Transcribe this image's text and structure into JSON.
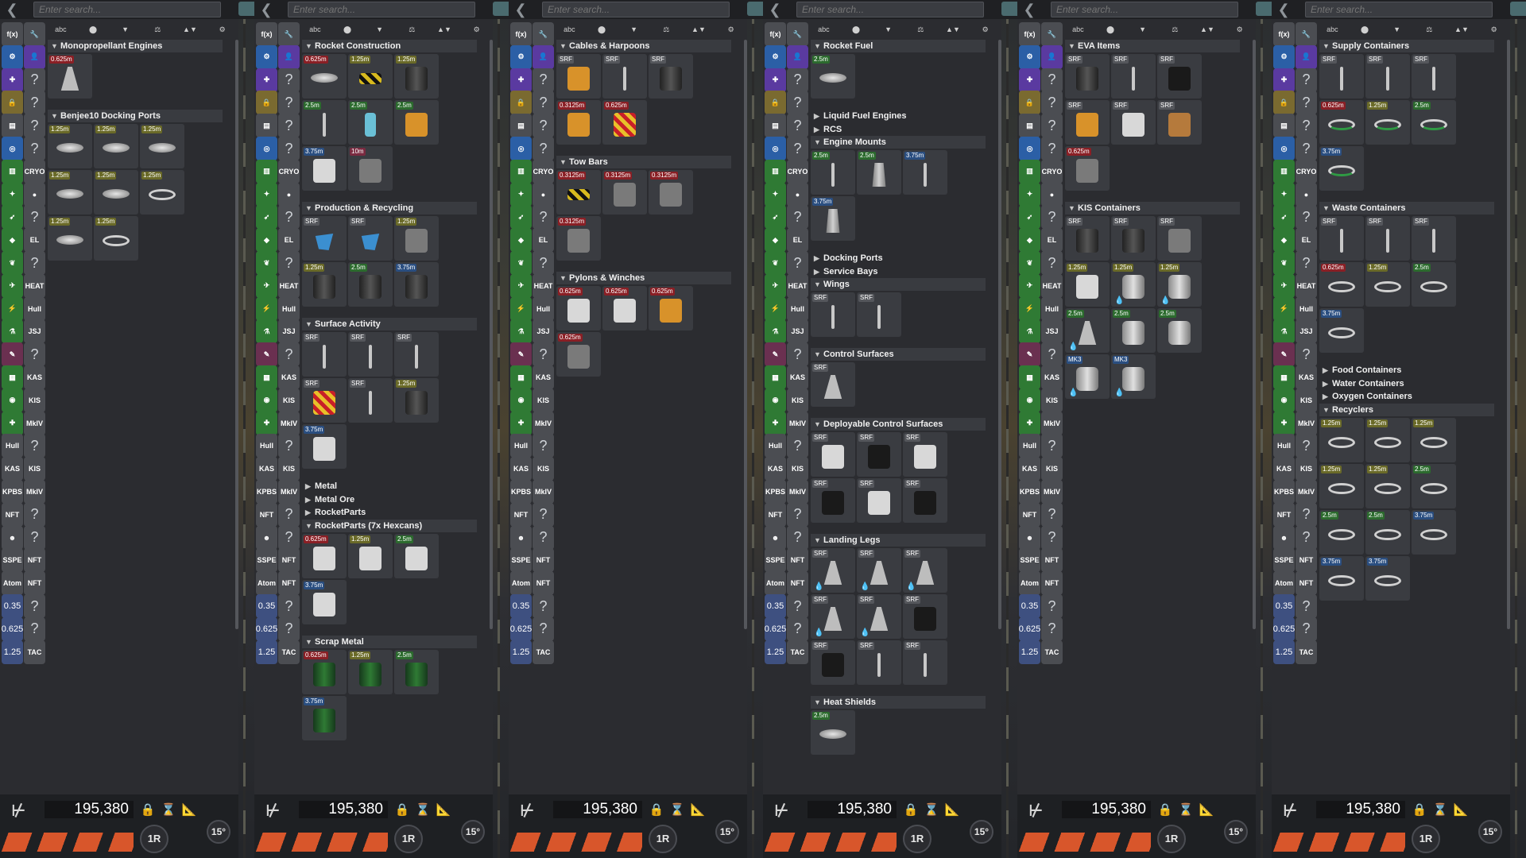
{
  "common": {
    "search_placeholder": "Enter search...",
    "filters": [
      "abc",
      "weight-icon",
      "funnel-icon",
      "scale-icon",
      "sort-icon",
      "gear-icon"
    ],
    "cost": "195,380",
    "rotate_label": "1R",
    "angle_label": "15°",
    "categories": [
      "fx",
      "wrench",
      "gear-blue",
      "user",
      "puzzle",
      "q",
      "lock-gold",
      "q",
      "factory",
      "q",
      "globe-blue",
      "q",
      "tank-green",
      "cryo",
      "satellite",
      "sphere",
      "rocket-green",
      "q",
      "probe-green",
      "el",
      "leaf",
      "q",
      "plane-green",
      "heat",
      "bolt-green",
      "hull",
      "science",
      "jsj",
      "nav",
      "q",
      "battery",
      "kas",
      "comms",
      "kis",
      "antenna",
      "mk",
      "hull",
      "q",
      "kas",
      "kis",
      "kpbs",
      "mkiv",
      "nft",
      "q",
      "mask",
      "q",
      "sspe",
      "nft",
      "atomic",
      "nft",
      "0.35",
      "q",
      "0.625",
      "q",
      "1.25",
      "tacls"
    ]
  },
  "panels": [
    {
      "sections": [
        {
          "title": "Monopropellant Engines",
          "collapsed": false,
          "items": [
            {
              "tag": "0.625m",
              "c": "red",
              "p": "p-cone"
            }
          ]
        },
        {
          "title": "Benjee10 Docking Ports",
          "collapsed": false,
          "items": [
            {
              "tag": "1.25m",
              "c": "olive",
              "p": "p-disk"
            },
            {
              "tag": "1.25m",
              "c": "olive",
              "p": "p-disk"
            },
            {
              "tag": "1.25m",
              "c": "olive",
              "p": "p-disk"
            },
            {
              "tag": "1.25m",
              "c": "olive",
              "p": "p-disk"
            },
            {
              "tag": "1.25m",
              "c": "olive",
              "p": "p-disk"
            },
            {
              "tag": "1.25m",
              "c": "olive",
              "p": "p-ring"
            },
            {
              "tag": "1.25m",
              "c": "olive",
              "p": "p-disk"
            },
            {
              "tag": "1.25m",
              "c": "olive",
              "p": "p-ring"
            }
          ]
        }
      ]
    },
    {
      "sections": [
        {
          "title": "Rocket Construction",
          "collapsed": false,
          "items": [
            {
              "tag": "0.625m",
              "c": "red",
              "p": "p-disk"
            },
            {
              "tag": "1.25m",
              "c": "olive",
              "p": "p-yel"
            },
            {
              "tag": "1.25m",
              "c": "olive",
              "p": "p-blk"
            },
            {
              "tag": "2.5m",
              "c": "green",
              "p": "p-thin"
            },
            {
              "tag": "2.5m",
              "c": "green",
              "p": "p-cyan"
            },
            {
              "tag": "2.5m",
              "c": "green",
              "p": "p-orange"
            },
            {
              "tag": "3.75m",
              "c": "blue",
              "p": "p-white"
            },
            {
              "tag": "10m",
              "c": "pink",
              "p": "p-gray"
            }
          ]
        },
        {
          "title": "Production & Recycling",
          "collapsed": false,
          "items": [
            {
              "tag": "SRF",
              "c": "gray",
              "p": "p-blue"
            },
            {
              "tag": "SRF",
              "c": "gray",
              "p": "p-blue"
            },
            {
              "tag": "1.25m",
              "c": "olive",
              "p": "p-gray"
            },
            {
              "tag": "1.25m",
              "c": "olive",
              "p": "p-blk"
            },
            {
              "tag": "2.5m",
              "c": "green",
              "p": "p-blk"
            },
            {
              "tag": "3.75m",
              "c": "blue",
              "p": "p-blk"
            }
          ]
        },
        {
          "title": "Surface Activity",
          "collapsed": false,
          "items": [
            {
              "tag": "SRF",
              "c": "gray",
              "p": "p-thin"
            },
            {
              "tag": "SRF",
              "c": "gray",
              "p": "p-thin"
            },
            {
              "tag": "SRF",
              "c": "gray",
              "p": "p-thin"
            },
            {
              "tag": "SRF",
              "c": "gray",
              "p": "p-red"
            },
            {
              "tag": "SRF",
              "c": "gray",
              "p": "p-thin"
            },
            {
              "tag": "1.25m",
              "c": "olive",
              "p": "p-blk"
            },
            {
              "tag": "3.75m",
              "c": "blue",
              "p": "p-white"
            }
          ]
        },
        {
          "title": "Metal",
          "collapsed": true,
          "items": []
        },
        {
          "title": "Metal Ore",
          "collapsed": true,
          "items": []
        },
        {
          "title": "RocketParts",
          "collapsed": true,
          "items": []
        },
        {
          "title": "RocketParts (7x Hexcans)",
          "collapsed": false,
          "items": [
            {
              "tag": "0.625m",
              "c": "red",
              "p": "p-white"
            },
            {
              "tag": "1.25m",
              "c": "olive",
              "p": "p-white"
            },
            {
              "tag": "2.5m",
              "c": "green",
              "p": "p-white"
            },
            {
              "tag": "3.75m",
              "c": "blue",
              "p": "p-white"
            }
          ]
        },
        {
          "title": "Scrap Metal",
          "collapsed": false,
          "items": [
            {
              "tag": "0.625m",
              "c": "red",
              "p": "p-green"
            },
            {
              "tag": "1.25m",
              "c": "olive",
              "p": "p-green"
            },
            {
              "tag": "2.5m",
              "c": "green",
              "p": "p-green"
            },
            {
              "tag": "3.75m",
              "c": "blue",
              "p": "p-green"
            }
          ]
        }
      ]
    },
    {
      "sections": [
        {
          "title": "Cables & Harpoons",
          "collapsed": false,
          "items": [
            {
              "tag": "SRF",
              "c": "gray",
              "p": "p-orange"
            },
            {
              "tag": "SRF",
              "c": "gray",
              "p": "p-thin"
            },
            {
              "tag": "SRF",
              "c": "gray",
              "p": "p-blk"
            },
            {
              "tag": "0.3125m",
              "c": "red",
              "p": "p-orange"
            },
            {
              "tag": "0.625m",
              "c": "red",
              "p": "p-red"
            }
          ]
        },
        {
          "title": "Tow Bars",
          "collapsed": false,
          "items": [
            {
              "tag": "0.3125m",
              "c": "red",
              "p": "p-yel"
            },
            {
              "tag": "0.3125m",
              "c": "red",
              "p": "p-gray"
            },
            {
              "tag": "0.3125m",
              "c": "red",
              "p": "p-gray"
            },
            {
              "tag": "0.3125m",
              "c": "red",
              "p": "p-gray"
            }
          ]
        },
        {
          "title": "Pylons & Winches",
          "collapsed": false,
          "items": [
            {
              "tag": "0.625m",
              "c": "red",
              "p": "p-white"
            },
            {
              "tag": "0.625m",
              "c": "red",
              "p": "p-white"
            },
            {
              "tag": "0.625m",
              "c": "red",
              "p": "p-orange"
            },
            {
              "tag": "0.625m",
              "c": "red",
              "p": "p-gray"
            }
          ]
        }
      ]
    },
    {
      "sections": [
        {
          "title": "Rocket Fuel",
          "collapsed": false,
          "items": [
            {
              "tag": "2.5m",
              "c": "green",
              "p": "p-disk"
            }
          ]
        },
        {
          "title": "Liquid Fuel Engines",
          "collapsed": true,
          "items": []
        },
        {
          "title": "RCS",
          "collapsed": true,
          "items": []
        },
        {
          "title": "Engine Mounts",
          "collapsed": false,
          "items": [
            {
              "tag": "2.5m",
              "c": "green",
              "p": "p-thin"
            },
            {
              "tag": "2.5m",
              "c": "green",
              "p": "p-fan"
            },
            {
              "tag": "3.75m",
              "c": "blue",
              "p": "p-thin"
            },
            {
              "tag": "3.75m",
              "c": "blue",
              "p": "p-fan"
            }
          ]
        },
        {
          "title": "Docking Ports",
          "collapsed": true,
          "items": []
        },
        {
          "title": "Service Bays",
          "collapsed": true,
          "items": []
        },
        {
          "title": "Wings",
          "collapsed": false,
          "items": [
            {
              "tag": "SRF",
              "c": "gray",
              "p": "p-thin"
            },
            {
              "tag": "SRF",
              "c": "gray",
              "p": "p-thin"
            }
          ]
        },
        {
          "title": "Control Surfaces",
          "collapsed": false,
          "items": [
            {
              "tag": "SRF",
              "c": "gray",
              "p": "p-cone"
            }
          ]
        },
        {
          "title": "Deployable Control Surfaces",
          "collapsed": false,
          "items": [
            {
              "tag": "SRF",
              "c": "gray",
              "p": "p-white"
            },
            {
              "tag": "SRF",
              "c": "gray",
              "p": "p-dark"
            },
            {
              "tag": "SRF",
              "c": "gray",
              "p": "p-white"
            },
            {
              "tag": "SRF",
              "c": "gray",
              "p": "p-dark"
            },
            {
              "tag": "SRF",
              "c": "gray",
              "p": "p-white"
            },
            {
              "tag": "SRF",
              "c": "gray",
              "p": "p-dark"
            }
          ]
        },
        {
          "title": "Landing Legs",
          "collapsed": false,
          "items": [
            {
              "tag": "SRF",
              "c": "gray",
              "p": "p-cone",
              "drop": true
            },
            {
              "tag": "SRF",
              "c": "gray",
              "p": "p-cone",
              "drop": true
            },
            {
              "tag": "SRF",
              "c": "gray",
              "p": "p-cone",
              "drop": true
            },
            {
              "tag": "SRF",
              "c": "gray",
              "p": "p-cone",
              "drop": true
            },
            {
              "tag": "SRF",
              "c": "gray",
              "p": "p-cone",
              "drop": true
            },
            {
              "tag": "SRF",
              "c": "gray",
              "p": "p-dark"
            },
            {
              "tag": "SRF",
              "c": "gray",
              "p": "p-dark"
            },
            {
              "tag": "SRF",
              "c": "gray",
              "p": "p-thin"
            },
            {
              "tag": "SRF",
              "c": "gray",
              "p": "p-thin"
            }
          ]
        },
        {
          "title": "Heat Shields",
          "collapsed": false,
          "items": [
            {
              "tag": "2.5m",
              "c": "green",
              "p": "p-disk"
            }
          ]
        }
      ]
    },
    {
      "sections": [
        {
          "title": "EVA Items",
          "collapsed": false,
          "items": [
            {
              "tag": "SRF",
              "c": "gray",
              "p": "p-blk"
            },
            {
              "tag": "SRF",
              "c": "gray",
              "p": "p-thin"
            },
            {
              "tag": "SRF",
              "c": "gray",
              "p": "p-dark"
            },
            {
              "tag": "SRF",
              "c": "gray",
              "p": "p-orange"
            },
            {
              "tag": "SRF",
              "c": "gray",
              "p": "p-white"
            },
            {
              "tag": "SRF",
              "c": "gray",
              "p": "p-box"
            },
            {
              "tag": "0.625m",
              "c": "red",
              "p": "p-gray"
            }
          ]
        },
        {
          "title": "KIS Containers",
          "collapsed": false,
          "items": [
            {
              "tag": "SRF",
              "c": "gray",
              "p": "p-blk"
            },
            {
              "tag": "SRF",
              "c": "gray",
              "p": "p-blk"
            },
            {
              "tag": "SRF",
              "c": "gray",
              "p": "p-gray"
            },
            {
              "tag": "1.25m",
              "c": "olive",
              "p": "p-white"
            },
            {
              "tag": "1.25m",
              "c": "olive",
              "p": "p-cyl",
              "drop": true
            },
            {
              "tag": "1.25m",
              "c": "olive",
              "p": "p-cyl",
              "drop": true
            },
            {
              "tag": "2.5m",
              "c": "green",
              "p": "p-cone",
              "drop": true
            },
            {
              "tag": "2.5m",
              "c": "green",
              "p": "p-cyl"
            },
            {
              "tag": "2.5m",
              "c": "green",
              "p": "p-cyl"
            },
            {
              "tag": "MK3",
              "c": "blue",
              "p": "p-cyl",
              "drop": true
            },
            {
              "tag": "MK3",
              "c": "blue",
              "p": "p-cyl",
              "drop": true
            }
          ]
        }
      ]
    },
    {
      "sections": [
        {
          "title": "Supply Containers",
          "collapsed": false,
          "items": [
            {
              "tag": "SRF",
              "c": "gray",
              "p": "p-thin"
            },
            {
              "tag": "SRF",
              "c": "gray",
              "p": "p-thin"
            },
            {
              "tag": "SRF",
              "c": "gray",
              "p": "p-thin"
            },
            {
              "tag": "0.625m",
              "c": "red",
              "p": "p-ring-g"
            },
            {
              "tag": "1.25m",
              "c": "olive",
              "p": "p-ring-g"
            },
            {
              "tag": "2.5m",
              "c": "green",
              "p": "p-ring-g"
            },
            {
              "tag": "3.75m",
              "c": "blue",
              "p": "p-ring-g"
            }
          ]
        },
        {
          "title": "Waste Containers",
          "collapsed": false,
          "items": [
            {
              "tag": "SRF",
              "c": "gray",
              "p": "p-thin"
            },
            {
              "tag": "SRF",
              "c": "gray",
              "p": "p-thin"
            },
            {
              "tag": "SRF",
              "c": "gray",
              "p": "p-thin"
            },
            {
              "tag": "0.625m",
              "c": "red",
              "p": "p-ring"
            },
            {
              "tag": "1.25m",
              "c": "olive",
              "p": "p-ring"
            },
            {
              "tag": "2.5m",
              "c": "green",
              "p": "p-ring"
            },
            {
              "tag": "3.75m",
              "c": "blue",
              "p": "p-ring"
            }
          ]
        },
        {
          "title": "Food Containers",
          "collapsed": true,
          "items": []
        },
        {
          "title": "Water Containers",
          "collapsed": true,
          "items": []
        },
        {
          "title": "Oxygen Containers",
          "collapsed": true,
          "items": []
        },
        {
          "title": "Recyclers",
          "collapsed": false,
          "items": [
            {
              "tag": "1.25m",
              "c": "olive",
              "p": "p-ring"
            },
            {
              "tag": "1.25m",
              "c": "olive",
              "p": "p-ring"
            },
            {
              "tag": "1.25m",
              "c": "olive",
              "p": "p-ring"
            },
            {
              "tag": "1.25m",
              "c": "olive",
              "p": "p-ring"
            },
            {
              "tag": "1.25m",
              "c": "olive",
              "p": "p-ring"
            },
            {
              "tag": "2.5m",
              "c": "green",
              "p": "p-ring"
            },
            {
              "tag": "2.5m",
              "c": "green",
              "p": "p-ring"
            },
            {
              "tag": "2.5m",
              "c": "green",
              "p": "p-ring"
            },
            {
              "tag": "3.75m",
              "c": "blue",
              "p": "p-ring"
            },
            {
              "tag": "3.75m",
              "c": "blue",
              "p": "p-ring"
            },
            {
              "tag": "3.75m",
              "c": "blue",
              "p": "p-ring"
            }
          ]
        }
      ]
    }
  ]
}
